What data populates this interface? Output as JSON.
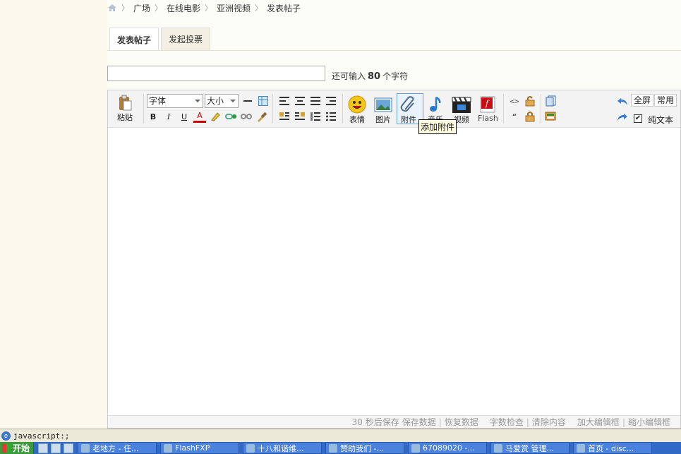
{
  "breadcrumb": [
    "广场",
    "在线电影",
    "亚洲视频",
    "发表帖子"
  ],
  "tabs": [
    "发表帖子",
    "发起投票"
  ],
  "title_input": {
    "value": "",
    "placeholder": ""
  },
  "counter": {
    "prefix": "还可输入",
    "count": "80",
    "suffix": "个字符"
  },
  "toolbar": {
    "paste": "粘贴",
    "font_select": "字体",
    "size_select": "大小",
    "emoticon": "表情",
    "image": "图片",
    "attachment": "附件",
    "music": "音乐",
    "video": "视频",
    "flash": "Flash",
    "fullscreen": "全屏",
    "common": "常用",
    "plaintext": "纯文本",
    "plaintext_checked": "✔",
    "bold": "B",
    "italic": "I",
    "underline": "U",
    "fontcolor": "A",
    "tooltip": "添加附件"
  },
  "statusbar": {
    "autosave": "30 秒后保存",
    "save": "保存数据",
    "restore": "恢复数据",
    "wordcount": "字数检查",
    "clear": "清除内容",
    "enlarge": "加大编辑框",
    "shrink": "缩小编辑框"
  },
  "browser_status": "javascript:;",
  "taskbar": {
    "start": "开始",
    "tasks": [
      "老地方 - 任...",
      "FlashFXP",
      "十八和谐维...",
      "赞助我们 -...",
      "67089020 -...",
      "马爱赏 管理...",
      "首页 - disc..."
    ]
  },
  "colors": {
    "accent": "#3169c6",
    "tooltip_bg": "#ffffe1",
    "start_green": "#3c9a3c"
  }
}
